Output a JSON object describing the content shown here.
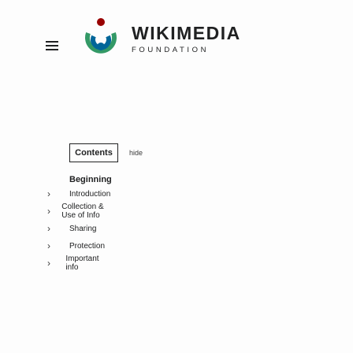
{
  "header": {
    "logo_title": "WIKIMEDIA",
    "logo_subtitle": "FOUNDATION",
    "menu_icon": "hamburger-menu-icon",
    "logo_icon": "wikimedia-logo-icon"
  },
  "toc": {
    "title": "Contents",
    "hide_label": "hide",
    "section_label": "Beginning",
    "items": [
      {
        "label": "Introduction",
        "icon": "chevron-right-icon"
      },
      {
        "label": "Collection & Use of Info",
        "icon": "chevron-right-icon"
      },
      {
        "label": "Sharing",
        "icon": "chevron-right-icon"
      },
      {
        "label": "Protection",
        "icon": "chevron-right-icon"
      },
      {
        "label": "Important info",
        "icon": "chevron-right-icon"
      }
    ]
  },
  "colors": {
    "logo_blue": "#006699",
    "logo_green": "#339966",
    "logo_red": "#990000",
    "text": "#202122"
  }
}
